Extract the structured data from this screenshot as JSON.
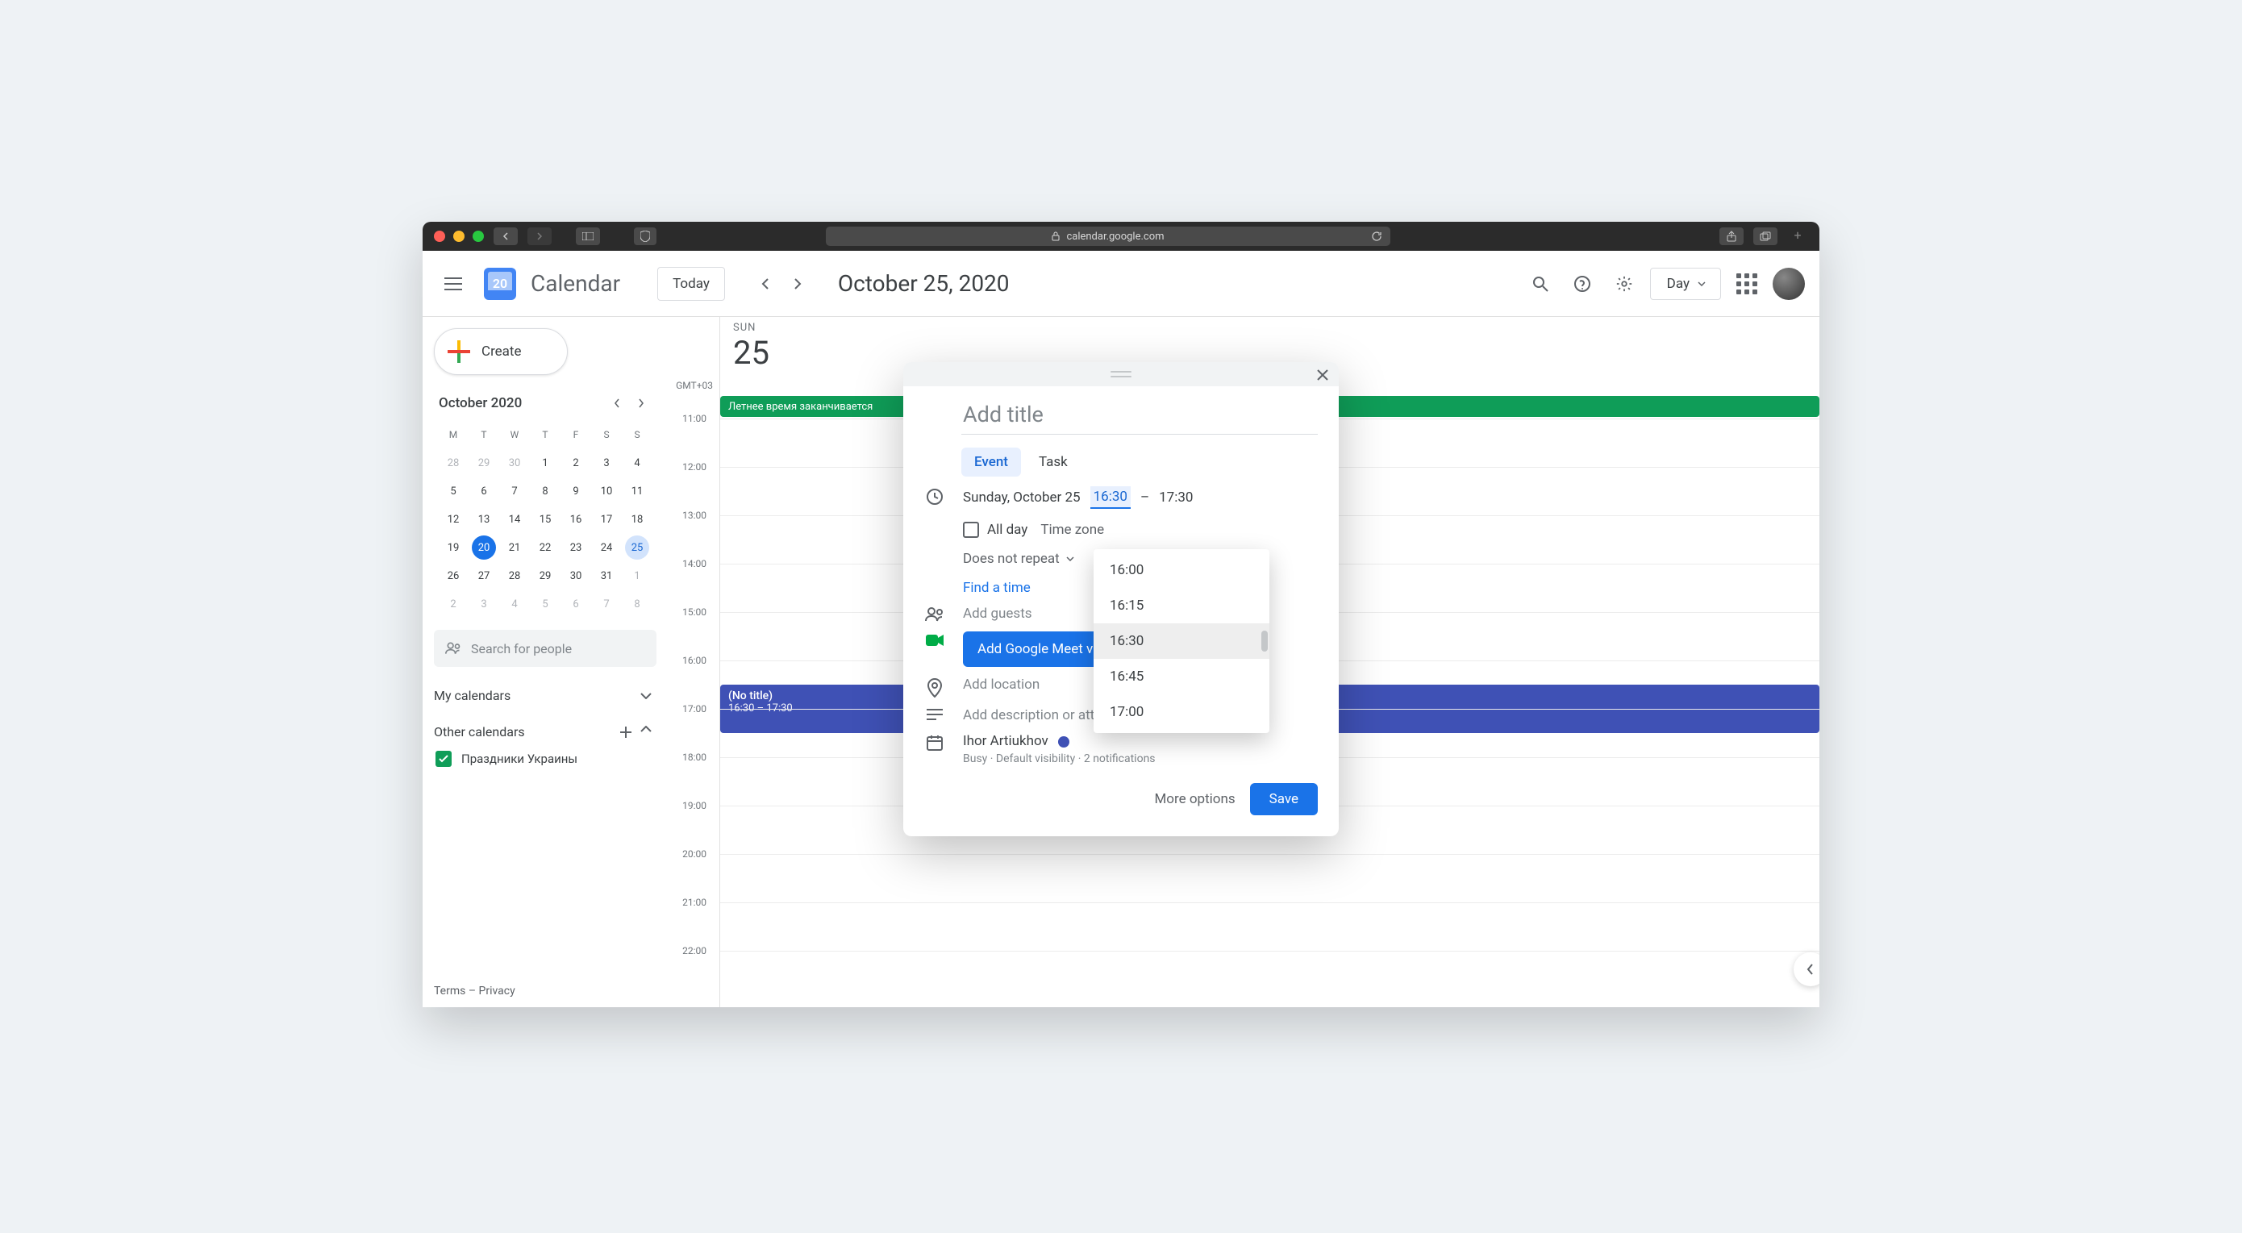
{
  "browser": {
    "url": "calendar.google.com"
  },
  "header": {
    "app_name": "Calendar",
    "logo_day": "20",
    "today_label": "Today",
    "date_heading": "October 25, 2020",
    "view_label": "Day"
  },
  "sidebar": {
    "create_label": "Create",
    "mini_month": {
      "title": "October 2020",
      "dow": [
        "M",
        "T",
        "W",
        "T",
        "F",
        "S",
        "S"
      ],
      "weeks": [
        [
          {
            "d": "28",
            "other": true
          },
          {
            "d": "29",
            "other": true
          },
          {
            "d": "30",
            "other": true
          },
          {
            "d": "1"
          },
          {
            "d": "2"
          },
          {
            "d": "3"
          },
          {
            "d": "4"
          }
        ],
        [
          {
            "d": "5"
          },
          {
            "d": "6"
          },
          {
            "d": "7"
          },
          {
            "d": "8"
          },
          {
            "d": "9"
          },
          {
            "d": "10"
          },
          {
            "d": "11"
          }
        ],
        [
          {
            "d": "12"
          },
          {
            "d": "13"
          },
          {
            "d": "14"
          },
          {
            "d": "15"
          },
          {
            "d": "16"
          },
          {
            "d": "17"
          },
          {
            "d": "18"
          }
        ],
        [
          {
            "d": "19"
          },
          {
            "d": "20",
            "today": true
          },
          {
            "d": "21"
          },
          {
            "d": "22"
          },
          {
            "d": "23"
          },
          {
            "d": "24"
          },
          {
            "d": "25",
            "selected": true
          }
        ],
        [
          {
            "d": "26"
          },
          {
            "d": "27"
          },
          {
            "d": "28"
          },
          {
            "d": "29"
          },
          {
            "d": "30"
          },
          {
            "d": "31"
          },
          {
            "d": "1",
            "other": true
          }
        ],
        [
          {
            "d": "2",
            "other": true
          },
          {
            "d": "3",
            "other": true
          },
          {
            "d": "4",
            "other": true
          },
          {
            "d": "5",
            "other": true
          },
          {
            "d": "6",
            "other": true
          },
          {
            "d": "7",
            "other": true
          },
          {
            "d": "8",
            "other": true
          }
        ]
      ]
    },
    "search_placeholder": "Search for people",
    "my_calendars_label": "My calendars",
    "other_calendars_label": "Other calendars",
    "other_calendars": [
      {
        "name": "Праздники Украины",
        "checked": true
      }
    ],
    "footer_terms": "Terms",
    "footer_privacy": "Privacy"
  },
  "day": {
    "gmt": "GMT+03",
    "dow": "SUN",
    "dom": "25",
    "hours": [
      "11:00",
      "12:00",
      "13:00",
      "14:00",
      "15:00",
      "16:00",
      "17:00",
      "18:00",
      "19:00",
      "20:00",
      "21:00",
      "22:00"
    ],
    "allday_event_title": "Летнее время заканчивается",
    "event": {
      "title": "(No title)",
      "time": "16:30 – 17:30"
    }
  },
  "popover": {
    "title_placeholder": "Add title",
    "tab_event": "Event",
    "tab_task": "Task",
    "date_text": "Sunday, October 25",
    "start_time": "16:30",
    "dash": "–",
    "end_time": "17:30",
    "all_day": "All day",
    "time_zone": "Time zone",
    "repeat": "Does not repeat",
    "find_time": "Find a time",
    "add_guests": "Add guests",
    "meet_label": "Add Google Meet video conferencing",
    "add_location": "Add location",
    "add_description": "Add description or attachments",
    "organizer": "Ihor Artiukhov",
    "status_line": "Busy · Default visibility · 2 notifications",
    "more_options": "More options",
    "save": "Save",
    "time_options": [
      "16:00",
      "16:15",
      "16:30",
      "16:45",
      "17:00"
    ],
    "time_selected_index": 2
  }
}
